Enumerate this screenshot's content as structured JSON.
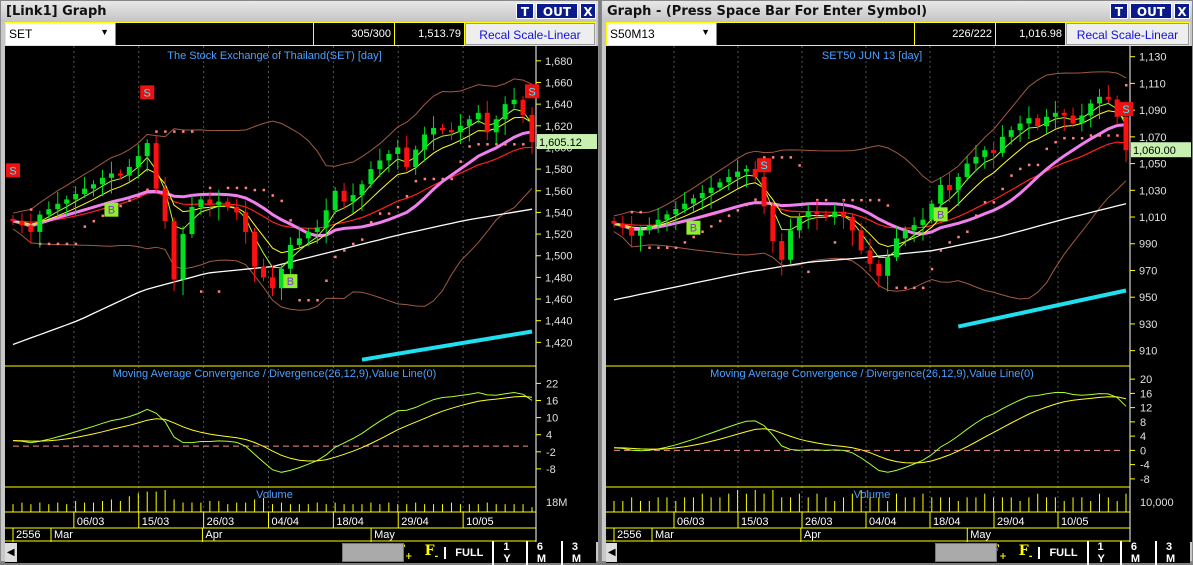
{
  "panels": [
    {
      "title": "[Link1] Graph",
      "symbol": "SET",
      "count": "305/300",
      "last": "1,513.79",
      "recal": "Recal Scale-Linear",
      "buttons": {
        "t": "T",
        "out": "OUT",
        "x": "X"
      },
      "chart_title": "The Stock Exchange of Thailand(SET) [day]",
      "current_price": "1,605.12",
      "price_axis": {
        "min": 1400,
        "max": 1690,
        "ticks": [
          1420,
          1440,
          1460,
          1480,
          1500,
          1520,
          1540,
          1560,
          1580,
          1600,
          1620,
          1640,
          1660,
          1680
        ]
      },
      "closes": [
        1532,
        1528,
        1522,
        1538,
        1543,
        1548,
        1552,
        1557,
        1562,
        1566,
        1572,
        1576,
        1574,
        1582,
        1592,
        1604,
        1562,
        1532,
        1478,
        1520,
        1545,
        1552,
        1547,
        1550,
        1545,
        1540,
        1522,
        1490,
        1480,
        1470,
        1488,
        1510,
        1516,
        1522,
        1526,
        1542,
        1560,
        1550,
        1556,
        1566,
        1580,
        1588,
        1594,
        1600,
        1582,
        1598,
        1612,
        1618,
        1616,
        1614,
        1620,
        1626,
        1632,
        1614,
        1626,
        1640,
        1644,
        1630,
        1605
      ],
      "long_ma": [
        1418,
        1440,
        1468,
        1484,
        1490,
        1505,
        1520,
        1533,
        1543
      ],
      "trend_line": {
        "start": 1404,
        "end": 1430
      },
      "signals": [
        {
          "type": "S",
          "index": 0
        },
        {
          "type": "S",
          "index": 15
        },
        {
          "type": "B",
          "index": 11
        },
        {
          "type": "B",
          "index": 31
        },
        {
          "type": "S",
          "index": 58
        }
      ],
      "macd_title": "Moving Average Convergence / Divergence(26,12,9),Value Line(0)",
      "macd_axis": {
        "min": -14,
        "max": 26,
        "ticks": [
          22,
          16,
          10,
          4,
          -2,
          -8
        ]
      },
      "volume_title": "Volume",
      "volume_axis_label": "18M",
      "volumes": [
        5,
        6,
        5,
        6,
        5,
        6,
        5,
        7,
        6,
        6,
        7,
        8,
        7,
        10,
        12,
        13,
        13,
        14,
        8,
        6,
        6,
        6,
        7,
        7,
        5,
        6,
        6,
        8,
        9,
        5,
        6,
        5,
        5,
        5,
        6,
        5,
        6,
        5,
        5,
        5,
        6,
        5,
        6,
        5,
        5,
        6,
        5,
        5,
        5,
        6,
        5,
        5,
        5,
        6,
        5,
        5,
        5,
        5,
        3
      ],
      "dates": [
        "06/03",
        "15/03",
        "26/03",
        "04/04",
        "18/04",
        "29/04",
        "10/05"
      ],
      "year": "2556",
      "months": [
        "Mar",
        "Apr",
        "May"
      ],
      "nav": [
        "FULL",
        "1 Y",
        "6 M",
        "3 M"
      ]
    },
    {
      "title": "Graph  - (Press Space Bar For Enter Symbol)",
      "symbol": "S50M13",
      "count": "226/222",
      "last": "1,016.98",
      "recal": "Recal Scale-Linear",
      "buttons": {
        "t": "T",
        "out": "OUT",
        "x": "X"
      },
      "chart_title": "SET50 JUN 13   [day]",
      "current_price": "1,060.00",
      "price_axis": {
        "min": 900,
        "max": 1135,
        "ticks": [
          910,
          930,
          950,
          970,
          990,
          1010,
          1030,
          1050,
          1070,
          1090,
          1110,
          1130
        ]
      },
      "closes": [
        1005,
        1002,
        996,
        1000,
        1004,
        1008,
        1012,
        1016,
        1020,
        1024,
        1028,
        1032,
        1036,
        1040,
        1044,
        1046,
        1040,
        1018,
        992,
        978,
        1000,
        1010,
        1014,
        1012,
        1010,
        1014,
        1010,
        1000,
        985,
        975,
        966,
        980,
        994,
        1000,
        1004,
        1008,
        1020,
        1034,
        1030,
        1040,
        1050,
        1055,
        1060,
        1058,
        1070,
        1075,
        1080,
        1084,
        1078,
        1085,
        1088,
        1086,
        1080,
        1086,
        1095,
        1100,
        1098,
        1085,
        1060
      ],
      "long_ma": [
        948,
        958,
        968,
        976,
        980,
        985,
        995,
        1008,
        1020
      ],
      "trend_line": {
        "start": 928,
        "end": 955
      },
      "signals": [
        {
          "type": "B",
          "index": 9
        },
        {
          "type": "S",
          "index": 17
        },
        {
          "type": "B",
          "index": 37
        },
        {
          "type": "S",
          "index": 58
        }
      ],
      "macd_title": "Moving Average Convergence / Divergence(26,12,9),Value Line(0)",
      "macd_axis": {
        "min": -10,
        "max": 22,
        "ticks": [
          20,
          16,
          12,
          8,
          4,
          0,
          -4,
          -8
        ]
      },
      "volume_title": "Volume",
      "volume_axis_label": "10,000",
      "volumes": [
        3,
        3,
        4,
        3,
        3,
        4,
        4,
        3,
        4,
        4,
        5,
        4,
        4,
        5,
        6,
        5,
        6,
        5,
        6,
        4,
        4,
        5,
        4,
        5,
        4,
        3,
        4,
        5,
        6,
        4,
        4,
        3,
        5,
        4,
        4,
        5,
        4,
        4,
        4,
        3,
        4,
        4,
        5,
        4,
        4,
        4,
        3,
        4,
        5,
        4,
        4,
        3,
        4,
        4,
        3,
        5,
        4,
        3,
        5
      ],
      "dates": [
        "06/03",
        "15/03",
        "26/03",
        "04/04",
        "18/04",
        "29/04",
        "10/05"
      ],
      "year": "2556",
      "months": [
        "Mar",
        "Apr",
        "May"
      ],
      "nav": [
        "FULL",
        "1 Y",
        "6 M",
        "3 M"
      ]
    }
  ],
  "colors": {
    "up": "#00e020",
    "down": "#ff1010",
    "ema_fast": "#a8ff30",
    "ema_mid": "#ffff20",
    "ema_slow": "#ff2020",
    "ma_heavy": "#f080f0",
    "long_ma": "#ffffff",
    "trend": "#20e0f0",
    "band": "#a05a40",
    "sar": "#ff8080",
    "grid": "#ffff00",
    "axis_text": "#e0e0e0",
    "title_text": "#4aa0ff"
  }
}
